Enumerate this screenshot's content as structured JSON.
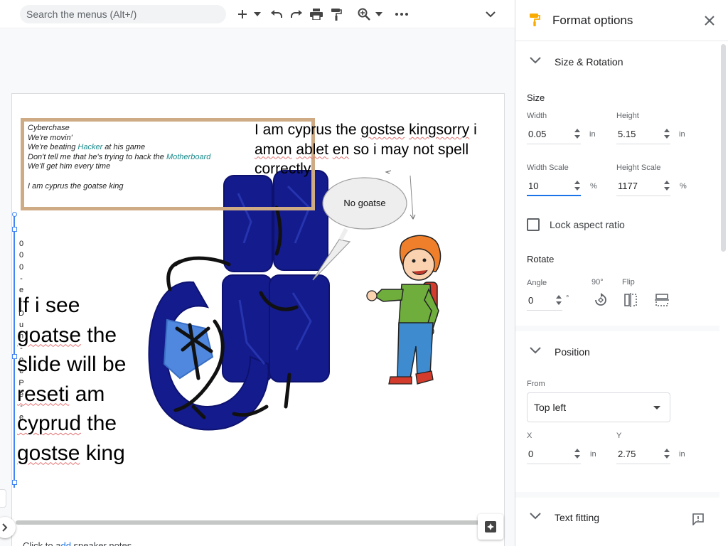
{
  "toolbar": {
    "search_placeholder": "Search the menus (Alt+/)",
    "icons": [
      "add-icon",
      "dropdown-icon",
      "undo-icon",
      "redo-icon",
      "print-icon",
      "paint-format-icon",
      "zoom-icon",
      "more-icon",
      "collapse-icon"
    ]
  },
  "slide": {
    "lyrics": {
      "line1": "Cyberchase",
      "line2": "We're movin'",
      "line3a": "We're beating ",
      "line3b": "Hacker",
      "line3c": " at his game",
      "line4a": "Don't tell me that he's trying to hack the ",
      "line4b": "Motherboard",
      "line5": "We'll get him every time",
      "line6": "I am cyprus the goatse king"
    },
    "top_text": {
      "a": "I am cyprus the ",
      "b": "gostse",
      "c": " ",
      "d": "kingsorry",
      "e": " i ",
      "f": "amon",
      "g": " ",
      "h": "ablet",
      "i": " ",
      "j": "en",
      "k": " so i may not spell correctly"
    },
    "bubble_text": "No goatse",
    "left_text": {
      "a": "If i see ",
      "b": "goatse",
      "c": " the slide will be ",
      "d": "reseti",
      "e": " am ",
      "f": "cyprud",
      "g": " the ",
      "h": "gostse",
      "i": " king"
    },
    "vertical_chars": [
      "0",
      "0",
      "0",
      "-",
      "e",
      "-",
      "D",
      "u",
      "n",
      "-",
      "o",
      "c",
      "P",
      "e",
      "-",
      "e"
    ]
  },
  "bottom": {
    "speaker_prefix": "Click to a",
    "speaker_link": "dd",
    "speaker_suffix": " speaker notes"
  },
  "panel": {
    "title": "Format options",
    "size_rotation": {
      "title": "Size & Rotation",
      "size_label": "Size",
      "width_label": "Width",
      "width_value": "0.05",
      "width_unit": "in",
      "height_label": "Height",
      "height_value": "5.15",
      "height_unit": "in",
      "width_scale_label": "Width Scale",
      "width_scale_value": "10",
      "width_scale_unit": "%",
      "height_scale_label": "Height Scale",
      "height_scale_value": "1177",
      "height_scale_unit": "%",
      "lock_label": "Lock aspect ratio",
      "rotate_label": "Rotate",
      "angle_label": "Angle",
      "angle_value": "0",
      "angle_unit": "°",
      "rotate90_label": "90°",
      "flip_label": "Flip"
    },
    "position": {
      "title": "Position",
      "from_label": "From",
      "from_value": "Top left",
      "x_label": "X",
      "x_value": "0",
      "x_unit": "in",
      "y_label": "Y",
      "y_value": "2.75",
      "y_unit": "in"
    },
    "text_fitting": {
      "title": "Text fitting"
    }
  },
  "colors": {
    "accent": "#1a73e8",
    "selection": "#4285f4",
    "lyrics_border": "#cfab85",
    "lyrics_highlight": "#1a8a8c",
    "sketch_dark_blue": "#141b8c",
    "sketch_light_blue": "#4f88de"
  }
}
